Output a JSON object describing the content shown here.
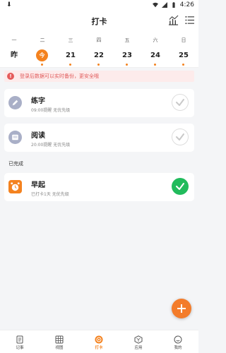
{
  "status": {
    "time": "4:26"
  },
  "header": {
    "title": "打卡"
  },
  "week": [
    {
      "dow": "一",
      "date": "昨",
      "today": false,
      "dot": false
    },
    {
      "dow": "二",
      "date": "今",
      "today": true,
      "dot": true
    },
    {
      "dow": "三",
      "date": "21",
      "today": false,
      "dot": true
    },
    {
      "dow": "四",
      "date": "22",
      "today": false,
      "dot": true
    },
    {
      "dow": "五",
      "date": "23",
      "today": false,
      "dot": true
    },
    {
      "dow": "六",
      "date": "24",
      "today": false,
      "dot": true
    },
    {
      "dow": "日",
      "date": "25",
      "today": false,
      "dot": true
    }
  ],
  "notice": {
    "text": "登录后数据可以实时备份，更安全哦"
  },
  "habits": [
    {
      "name": "练字",
      "sub": "09:00提醒  无优先级",
      "icon": "pen-icon",
      "color": "#a9afc7",
      "done": false
    },
    {
      "name": "阅读",
      "sub": "20:00提醒  无优先级",
      "icon": "book-icon",
      "color": "#a9afc7",
      "done": false
    }
  ],
  "completed_section": {
    "label": "已完成"
  },
  "completed": [
    {
      "name": "早起",
      "sub": "已打卡1天  无优先级",
      "icon": "alarm-clock-icon",
      "color": "#f4821f",
      "done": true
    }
  ],
  "tabs": [
    {
      "label": "记事",
      "icon": "notes-icon",
      "active": false
    },
    {
      "label": "视图",
      "icon": "grid-icon",
      "active": false
    },
    {
      "label": "打卡",
      "icon": "checkin-icon",
      "active": true
    },
    {
      "label": "应用",
      "icon": "apps-icon",
      "active": false
    },
    {
      "label": "我的",
      "icon": "profile-icon",
      "active": false
    }
  ],
  "colors": {
    "accent": "#f4821f",
    "done_green": "#21bb5c",
    "warn_red": "#e55b5b"
  }
}
